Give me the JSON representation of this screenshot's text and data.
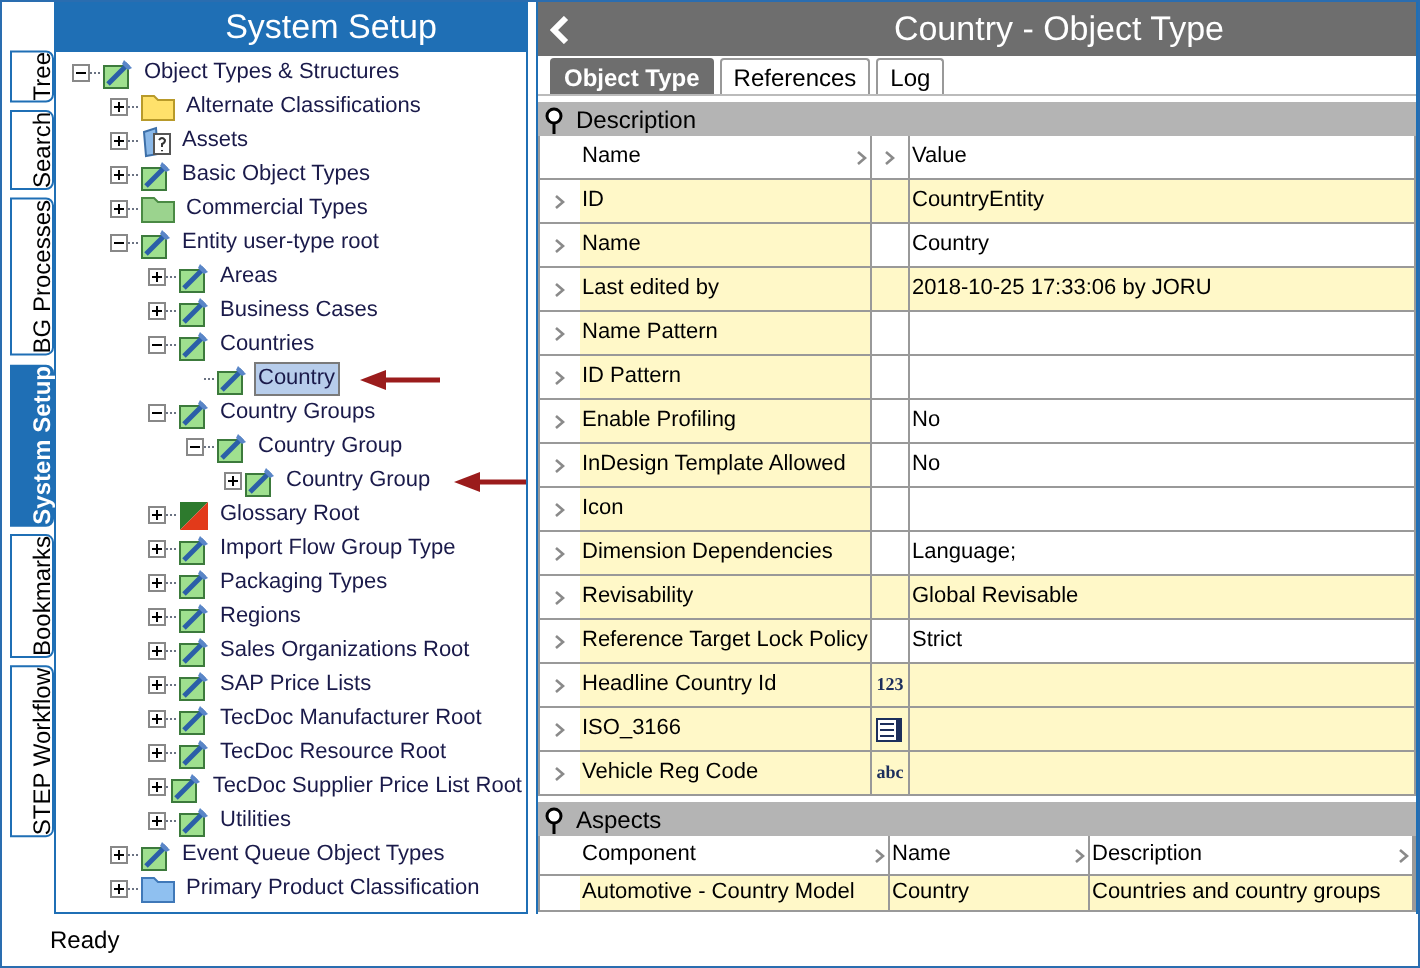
{
  "side_tabs": [
    {
      "label": "Tree",
      "selected": false
    },
    {
      "label": "Search",
      "selected": false
    },
    {
      "label": "BG Processes",
      "selected": false
    },
    {
      "label": "System Setup",
      "selected": true
    },
    {
      "label": "Bookmarks",
      "selected": false
    },
    {
      "label": "STEP Workflow",
      "selected": false
    }
  ],
  "tree_panel": {
    "title": "System Setup",
    "items": [
      {
        "label": "Object Types & Structures",
        "kind": "object-type",
        "expanded": true,
        "selected": false,
        "annotated": false,
        "children": [
          {
            "label": "Alternate Classifications",
            "kind": "folder-yellow",
            "expanded": false,
            "selected": false,
            "annotated": false
          },
          {
            "label": "Assets",
            "kind": "assets",
            "expanded": false,
            "selected": false,
            "annotated": false
          },
          {
            "label": "Basic Object Types",
            "kind": "object-type",
            "expanded": false,
            "selected": false,
            "annotated": false
          },
          {
            "label": "Commercial Types",
            "kind": "folder-green",
            "expanded": false,
            "selected": false,
            "annotated": false
          },
          {
            "label": "Entity user-type root",
            "kind": "object-type",
            "expanded": true,
            "selected": false,
            "annotated": false,
            "children": [
              {
                "label": "Areas",
                "kind": "object-type",
                "expanded": false,
                "selected": false,
                "annotated": false
              },
              {
                "label": "Business Cases",
                "kind": "object-type",
                "expanded": false,
                "selected": false,
                "annotated": false
              },
              {
                "label": "Countries",
                "kind": "object-type",
                "expanded": true,
                "selected": false,
                "annotated": false,
                "children": [
                  {
                    "label": "Country",
                    "kind": "object-type",
                    "selected": true,
                    "annotated": true
                  }
                ]
              },
              {
                "label": "Country Groups",
                "kind": "object-type",
                "expanded": true,
                "selected": false,
                "annotated": false,
                "children": [
                  {
                    "label": "Country Group",
                    "kind": "object-type",
                    "expanded": true,
                    "selected": false,
                    "annotated": false,
                    "children": [
                      {
                        "label": "Country Group",
                        "kind": "object-type",
                        "expanded": false,
                        "selected": false,
                        "annotated": true
                      }
                    ]
                  }
                ]
              },
              {
                "label": "Glossary Root",
                "kind": "glossary",
                "expanded": false,
                "selected": false,
                "annotated": false
              },
              {
                "label": "Import Flow Group Type",
                "kind": "object-type",
                "expanded": false,
                "selected": false,
                "annotated": false
              },
              {
                "label": "Packaging Types",
                "kind": "object-type",
                "expanded": false,
                "selected": false,
                "annotated": false
              },
              {
                "label": "Regions",
                "kind": "object-type",
                "expanded": false,
                "selected": false,
                "annotated": false
              },
              {
                "label": "Sales Organizations Root",
                "kind": "object-type",
                "expanded": false,
                "selected": false,
                "annotated": false
              },
              {
                "label": "SAP Price Lists",
                "kind": "object-type",
                "expanded": false,
                "selected": false,
                "annotated": false
              },
              {
                "label": "TecDoc Manufacturer Root",
                "kind": "object-type",
                "expanded": false,
                "selected": false,
                "annotated": false
              },
              {
                "label": "TecDoc Resource Root",
                "kind": "object-type",
                "expanded": false,
                "selected": false,
                "annotated": false
              },
              {
                "label": "TecDoc Supplier Price List Root",
                "kind": "object-type",
                "expanded": false,
                "selected": false,
                "annotated": false
              },
              {
                "label": "Utilities",
                "kind": "object-type",
                "expanded": false,
                "selected": false,
                "annotated": false
              }
            ]
          },
          {
            "label": "Event Queue Object Types",
            "kind": "object-type",
            "expanded": false,
            "selected": false,
            "annotated": false
          },
          {
            "label": "Primary Product Classification",
            "kind": "folder-blue",
            "expanded": false,
            "selected": false,
            "annotated": false
          }
        ]
      }
    ]
  },
  "detail": {
    "title": "Country - Object Type",
    "tabs": [
      {
        "label": "Object Type",
        "selected": true
      },
      {
        "label": "References",
        "selected": false
      },
      {
        "label": "Log",
        "selected": false
      }
    ],
    "description": {
      "title": "Description",
      "columns": [
        "Name",
        "Value"
      ],
      "rows": [
        {
          "kind": "text",
          "name": "ID",
          "value": "CountryEntity",
          "highlighted": true
        },
        {
          "kind": "text",
          "name": "Name",
          "value": "Country",
          "highlighted": false
        },
        {
          "kind": "text",
          "name": "Last edited by",
          "value": "2018-10-25 17:33:06 by JORU",
          "highlighted": true
        },
        {
          "kind": "text",
          "name": "Name Pattern",
          "highlighted": false
        },
        {
          "kind": "text",
          "name": "ID Pattern",
          "highlighted": false
        },
        {
          "kind": "text",
          "name": "Enable Profiling",
          "value": "No",
          "highlighted": false
        },
        {
          "kind": "text",
          "name": "InDesign Template Allowed",
          "value": "No",
          "highlighted": false
        },
        {
          "kind": "text",
          "name": "Icon",
          "highlighted": false
        },
        {
          "kind": "text",
          "name": "Dimension Dependencies",
          "value": "Language;",
          "highlighted": false
        },
        {
          "kind": "text",
          "name": "Revisability",
          "value": "Global Revisable",
          "highlighted": true
        },
        {
          "kind": "text",
          "name": "Reference Target Lock Policy",
          "value": "Strict",
          "highlighted": false
        },
        {
          "kind": "badge",
          "name": "Headline Country Id",
          "type_badge": "123",
          "highlighted": true
        },
        {
          "kind": "list",
          "name": "ISO_3166",
          "highlighted": true
        },
        {
          "kind": "badge",
          "name": "Vehicle Reg Code",
          "type_badge": "abc",
          "highlighted": true
        }
      ]
    },
    "aspects": {
      "title": "Aspects",
      "columns": [
        "Component",
        "Name",
        "Description"
      ],
      "rows": [
        [
          "Automotive - Country Model",
          "Country",
          "Countries and country groups"
        ]
      ]
    }
  },
  "status_bar": "Ready"
}
